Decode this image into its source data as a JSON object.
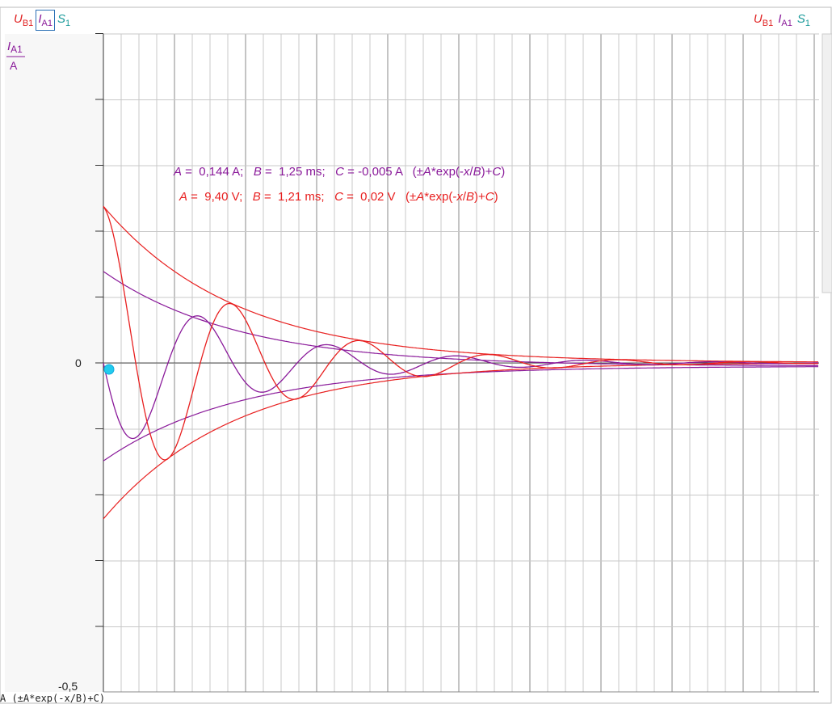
{
  "tabs_left": [
    {
      "sym": "U",
      "sub": "B1",
      "color": "#e02020",
      "selected": false
    },
    {
      "sym": "I",
      "sub": "A1",
      "color": "#8a1a9a",
      "selected": true
    },
    {
      "sym": "S",
      "sub": "1",
      "color": "#1a9a9a",
      "selected": false
    }
  ],
  "tabs_right": [
    {
      "sym": "U",
      "sub": "B1",
      "color": "#e02020"
    },
    {
      "sym": "I",
      "sub": "A1",
      "color": "#8a1a9a"
    },
    {
      "sym": "S",
      "sub": "1",
      "color": "#1a9a9a"
    }
  ],
  "axis": {
    "ylabel_num": "I",
    "ylabel_sub": "A1",
    "ylabel_den": "A",
    "zero_label": "0",
    "bottom_label": "-0,5"
  },
  "bottom_text": "A (±A*exp(-x/B)+C)",
  "colors": {
    "purple": "#8a1a9a",
    "red": "#e82020",
    "cursor": "#22ccee",
    "grid": "#c8c8c8",
    "grid_major": "#888888"
  },
  "chart_data": {
    "type": "line",
    "ylim": [
      -0.5,
      0.5
    ],
    "y_ticks_labeled": [
      "0",
      "-0,5"
    ],
    "series": [
      {
        "name": "I_A1",
        "kind": "damped_oscillation",
        "color": "#8a1a9a",
        "amplitude": 0.144,
        "decay_ms": 1.25,
        "offset": -0.005
      },
      {
        "name": "U_B1",
        "kind": "damped_oscillation",
        "color": "#e82020",
        "amplitude": 9.4,
        "decay_ms": 1.21,
        "offset": 0.02
      }
    ],
    "annotations": [
      {
        "color": "#8a1a9a",
        "parts": [
          {
            "t": "A",
            "i": true
          },
          {
            "t": " =  0,144 A;   "
          },
          {
            "t": "B",
            "i": true
          },
          {
            "t": " =  1,25 ms;   "
          },
          {
            "t": "C",
            "i": true
          },
          {
            "t": " = -0,005 A   (±"
          },
          {
            "t": "A",
            "i": true
          },
          {
            "t": "*exp(-"
          },
          {
            "t": "x",
            "i": true
          },
          {
            "t": "/"
          },
          {
            "t": "B",
            "i": true
          },
          {
            "t": ")+"
          },
          {
            "t": "C",
            "i": true
          },
          {
            "t": ")"
          }
        ]
      },
      {
        "color": "#e82020",
        "parts": [
          {
            "t": "A",
            "i": true
          },
          {
            "t": " =  9,40 V;   "
          },
          {
            "t": "B",
            "i": true
          },
          {
            "t": " =  1,21 ms;   "
          },
          {
            "t": "C",
            "i": true
          },
          {
            "t": " =  0,02 V   (±"
          },
          {
            "t": "A",
            "i": true
          },
          {
            "t": "*exp(-"
          },
          {
            "t": "x",
            "i": true
          },
          {
            "t": "/"
          },
          {
            "t": "B",
            "i": true
          },
          {
            "t": ")+"
          },
          {
            "t": "C",
            "i": true
          },
          {
            "t": ")"
          }
        ]
      }
    ]
  }
}
